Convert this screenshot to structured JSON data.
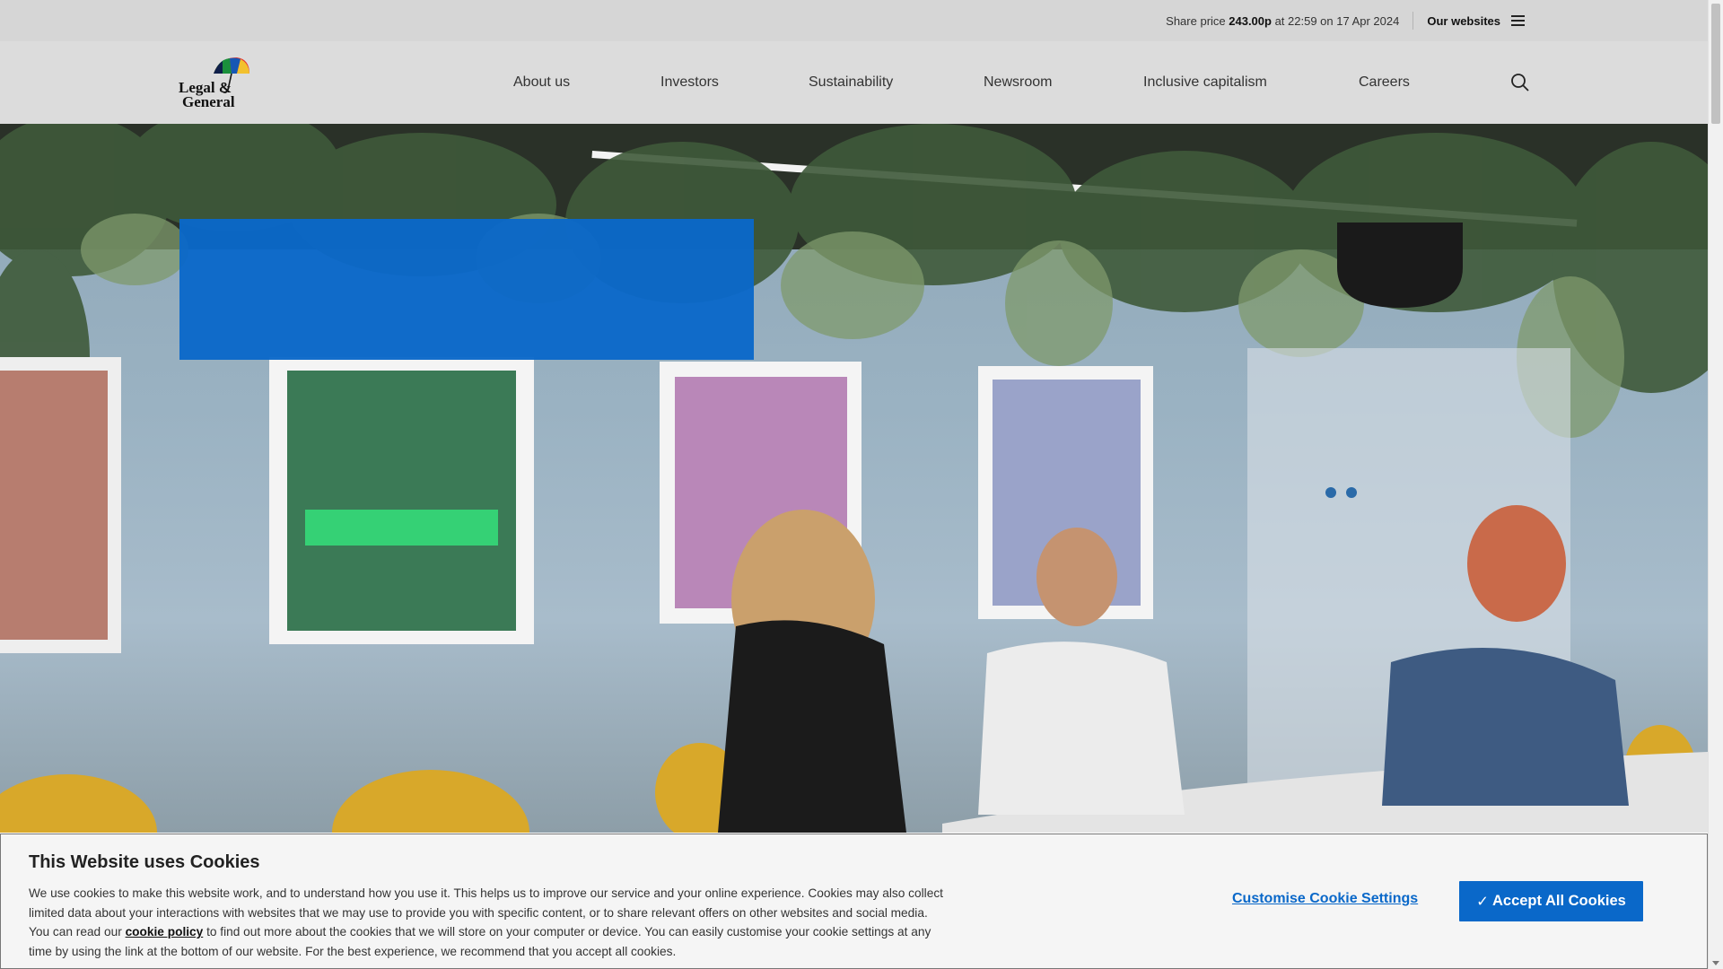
{
  "utility_bar": {
    "share_price_prefix": "Share price ",
    "share_price_value": "243.00p",
    "share_price_suffix": " at 22:59 on 17 Apr 2024",
    "our_websites_label": "Our websites"
  },
  "brand": {
    "logo_line1": "Legal &",
    "logo_line2": "General"
  },
  "nav": {
    "items": [
      {
        "label": "About us"
      },
      {
        "label": "Investors"
      },
      {
        "label": "Sustainability"
      },
      {
        "label": "Newsroom"
      },
      {
        "label": "Inclusive capitalism"
      },
      {
        "label": "Careers"
      }
    ]
  },
  "cookie_banner": {
    "title": "This Website uses Cookies",
    "text_part1": "We use cookies to make this website work, and to understand how you use it. This helps us to improve our service and your online experience. Cookies may also collect limited data about your interactions with websites that we may use to provide you with specific content, or to share relevant offers on other websites and social media. You can read our ",
    "policy_link": "cookie policy",
    "text_part2": " to find out more about the cookies that we will store on your computer or device. You can easily customise your cookie settings at any time by using the link at the bottom of our website. For the best experience, we recommend that you accept all cookies.",
    "customise_label": "Customise Cookie Settings",
    "accept_label": "Accept All Cookies",
    "accept_check": "✓"
  },
  "colors": {
    "accent": "#0a68c9",
    "utility_bar_bg": "#d6d6d6",
    "header_bg": "#dcdcdc",
    "cookie_bg": "#f5f5f5"
  },
  "icons": {
    "menu": "hamburger-icon",
    "search": "search-icon",
    "logo": "umbrella-logo"
  }
}
